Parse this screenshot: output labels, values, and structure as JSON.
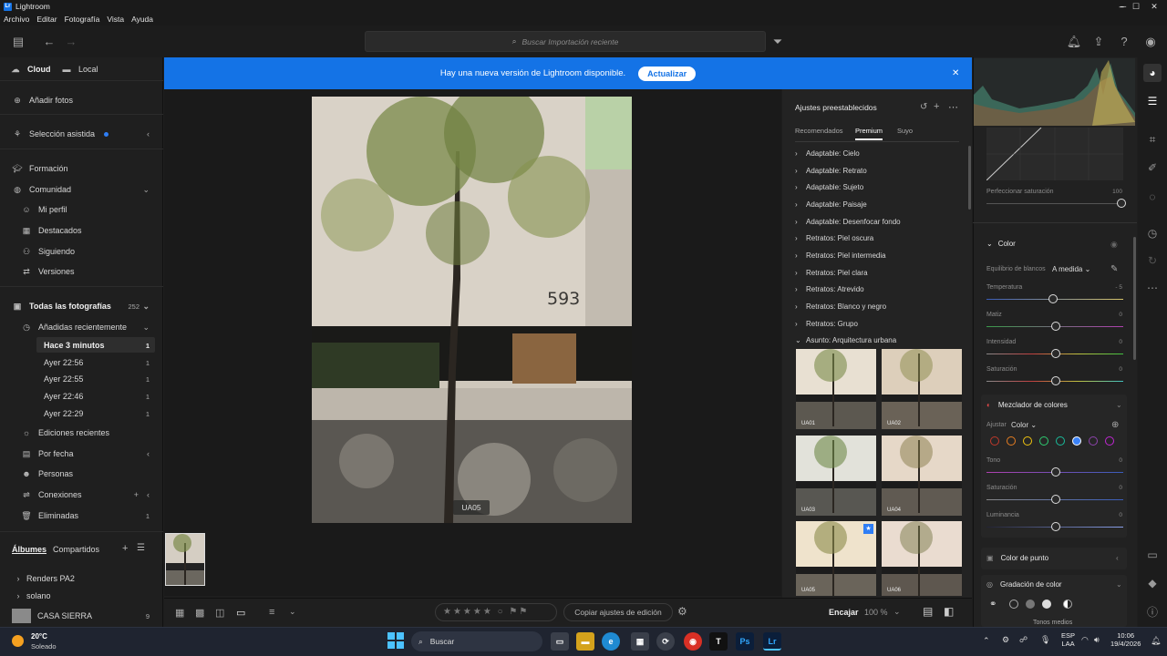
{
  "window": {
    "title": "Lightroom",
    "controls": [
      "minimize-icon",
      "maximize-icon",
      "close-icon"
    ]
  },
  "menu": {
    "items": [
      "Archivo",
      "Editar",
      "Fotografía",
      "Vista",
      "Ayuda"
    ]
  },
  "search": {
    "placeholder": "Buscar Importación reciente"
  },
  "banner": {
    "message": "Hay una nueva versión de Lightroom disponible.",
    "button": "Actualizar",
    "color": "#1473e6"
  },
  "sidebar": {
    "tabs": {
      "cloud": "Cloud",
      "local": "Local"
    },
    "add_photos": "Añadir fotos",
    "assisted": "Selección asistida",
    "learn": "Formación",
    "community": "Comunidad",
    "community_items": [
      "Mi perfil",
      "Destacados",
      "Siguiendo",
      "Versiones"
    ],
    "all_photos": "Todas las fotografías",
    "all_photos_count": "252",
    "recent_added": "Añadidas recientemente",
    "recent_items": [
      {
        "label": "Hace 3 minutos",
        "count": "1"
      },
      {
        "label": "Ayer 22:56",
        "count": "1"
      },
      {
        "label": "Ayer 22:55",
        "count": "1"
      },
      {
        "label": "Ayer 22:46",
        "count": "1"
      },
      {
        "label": "Ayer 22:29",
        "count": "1"
      }
    ],
    "recent_edits": "Ediciones recientes",
    "by_date": "Por fecha",
    "people": "Personas",
    "connections": "Conexiones",
    "deleted": "Eliminadas",
    "deleted_count": "1",
    "albums_tab": "Álbumes",
    "shared_tab": "Compartidos",
    "albums": [
      {
        "label": "Renders PA2"
      },
      {
        "label": "solano"
      },
      {
        "label": "CASA SIERRA",
        "count": "9"
      }
    ]
  },
  "photo": {
    "label": "UA05",
    "number_on_wall": "593"
  },
  "bottombar": {
    "fit_label": "Encajar",
    "zoom": "100 %",
    "copy_settings": "Copiar ajustes de edición"
  },
  "presets": {
    "title": "Ajustes preestablecidos",
    "tabs": [
      "Recomendados",
      "Premium",
      "Suyo"
    ],
    "active_tab": "Premium",
    "groups": [
      "Adaptable: Cielo",
      "Adaptable: Retrato",
      "Adaptable: Sujeto",
      "Adaptable: Paisaje",
      "Adaptable: Desenfocar fondo",
      "Retratos: Piel oscura",
      "Retratos: Piel intermedia",
      "Retratos: Piel clara",
      "Retratos: Atrevido",
      "Retratos: Blanco y negro",
      "Retratos: Grupo",
      "Asunto: Arquitectura urbana"
    ],
    "thumbs": [
      "UA01",
      "UA02",
      "UA03",
      "UA04",
      "UA05",
      "UA06"
    ]
  },
  "edit": {
    "saturation_refine": {
      "label": "Perfeccionar saturación",
      "value": "100"
    },
    "color_title": "Color",
    "wb_label": "Equilibrio de blancos",
    "wb_value": "A medida",
    "sliders": [
      {
        "label": "Temperatura",
        "value": "- 5",
        "pos": 0.48
      },
      {
        "label": "Matiz",
        "value": "0",
        "pos": 0.5
      },
      {
        "label": "Intensidad",
        "value": "0",
        "pos": 0.5
      },
      {
        "label": "Saturación",
        "value": "0",
        "pos": 0.5
      }
    ],
    "mixer_title": "Mezclador de colores",
    "adjust_label": "Ajustar",
    "adjust_value": "Color",
    "mixer_colors": [
      "#c0392b",
      "#e67e22",
      "#f1c40f",
      "#2ecc71",
      "#1abc9c",
      "#3b82f6",
      "#8e44ad",
      "#c026d3"
    ],
    "mixer_sliders": [
      {
        "label": "Tono",
        "value": "0",
        "pos": 0.5
      },
      {
        "label": "Saturación",
        "value": "0",
        "pos": 0.5
      },
      {
        "label": "Luminancia",
        "value": "0",
        "pos": 0.5
      }
    ],
    "point_color": "Color de punto",
    "grading": "Gradación de color",
    "grading_mode": "Tonos medios"
  },
  "taskbar": {
    "weather_temp": "20°C",
    "weather_desc": "Soleado",
    "search": "Buscar",
    "lang": "ESP",
    "lang2": "LAA",
    "time": "10:06",
    "date": "19/4/2026"
  }
}
